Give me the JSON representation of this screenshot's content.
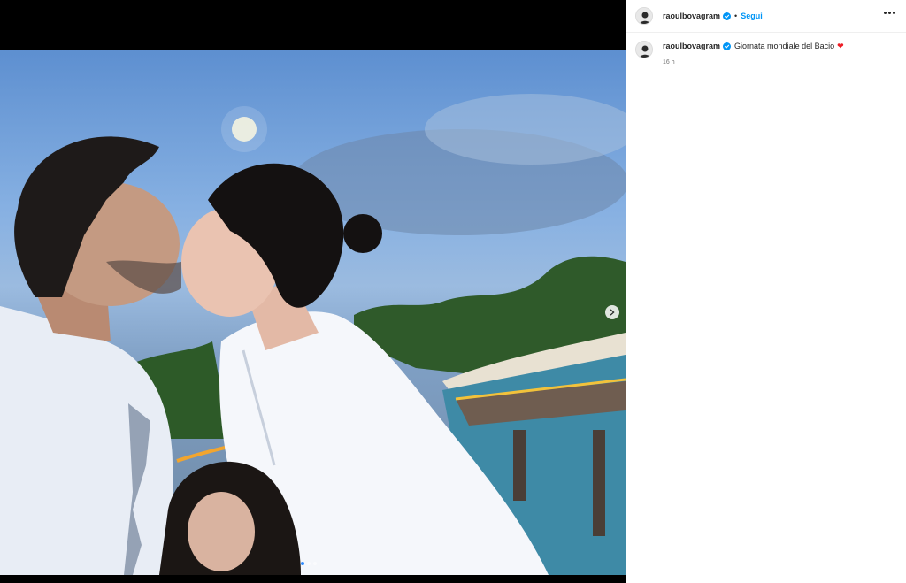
{
  "post": {
    "username": "raoulbovagram",
    "separator": "•",
    "follow_label": "Segui",
    "caption_username": "raoulbovagram",
    "caption_text": "Giornata mondiale del Bacio",
    "caption_emoji": "❤",
    "timestamp": "16 h"
  },
  "carousel": {
    "total": 3,
    "active_index": 0
  },
  "icons": {
    "verified": "verified-badge-icon",
    "more": "more-options-icon",
    "next": "chevron-right-icon"
  },
  "colors": {
    "follow": "#0095f6",
    "verified": "#0095f6",
    "heart": "#ed1c24"
  }
}
